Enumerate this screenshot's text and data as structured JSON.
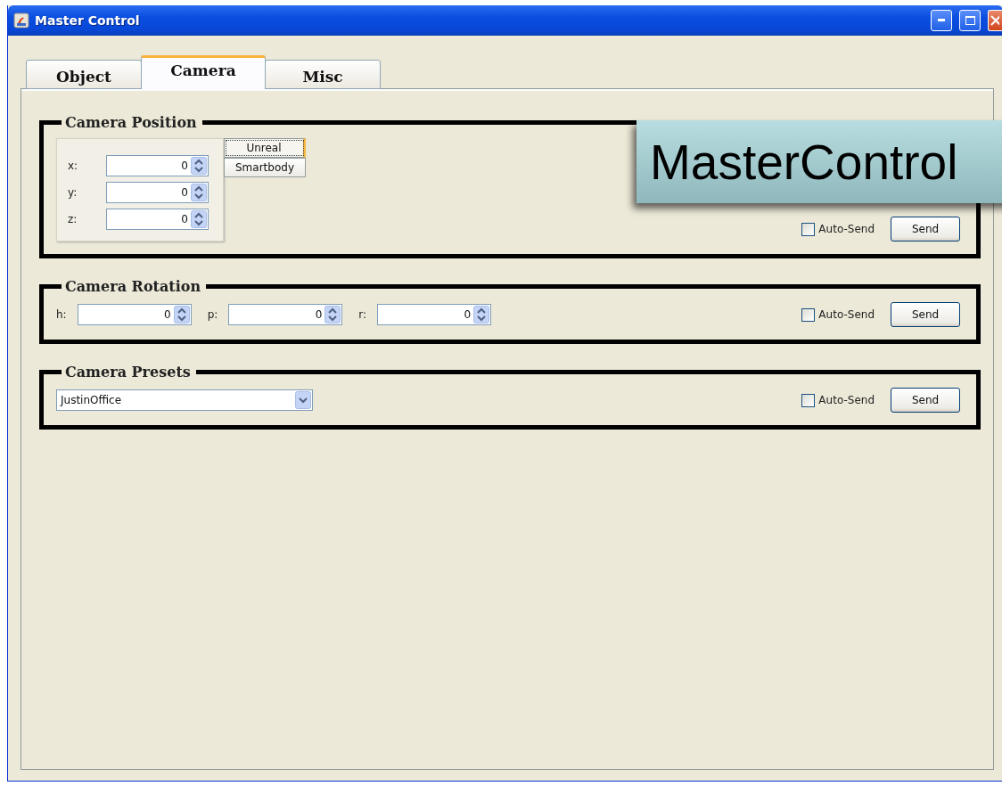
{
  "window": {
    "title": "Master Control"
  },
  "tabs": [
    {
      "label": "Object",
      "selected": false
    },
    {
      "label": "Camera",
      "selected": true
    },
    {
      "label": "Misc",
      "selected": false
    }
  ],
  "groups": [
    {
      "kind": "position",
      "title": "Camera Position",
      "fields": [
        {
          "label": "x:",
          "value": "0"
        },
        {
          "label": "y:",
          "value": "0"
        },
        {
          "label": "z:",
          "value": "0"
        }
      ],
      "modes": [
        {
          "label": "Unreal",
          "selected": true
        },
        {
          "label": "Smartbody",
          "selected": false
        }
      ],
      "auto_send": {
        "label": "Auto-Send",
        "checked": false
      },
      "send_button": "Send"
    },
    {
      "kind": "rotation",
      "title": "Camera Rotation",
      "fields": [
        {
          "label": "h:",
          "value": "0"
        },
        {
          "label": "p:",
          "value": "0"
        },
        {
          "label": "r:",
          "value": "0"
        }
      ],
      "auto_send": {
        "label": "Auto-Send",
        "checked": false
      },
      "send_button": "Send"
    },
    {
      "kind": "presets",
      "title": "Camera Presets",
      "preset": "JustinOffice",
      "auto_send": {
        "label": "Auto-Send",
        "checked": false
      },
      "send_button": "Send"
    }
  ],
  "overlay_label": "MasterControl"
}
